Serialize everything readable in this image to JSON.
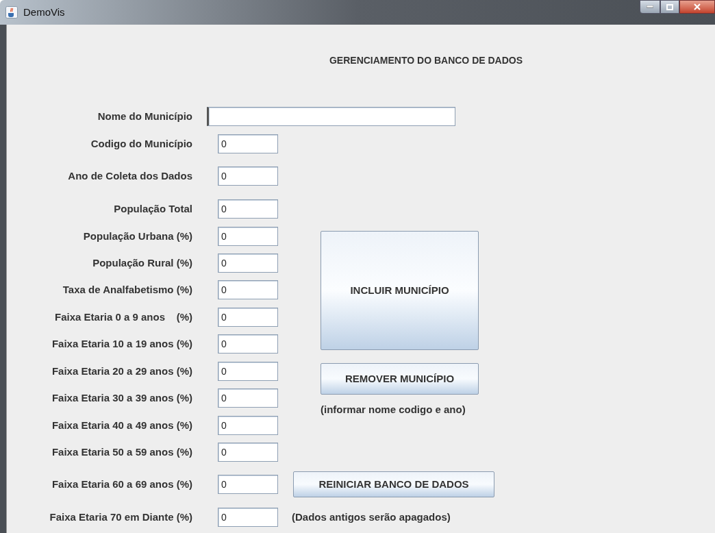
{
  "window": {
    "title": "DemoVis"
  },
  "heading": "GERENCIAMENTO DO BANCO DE DADOS",
  "fields": [
    {
      "label": "Nome do Município",
      "focused": true,
      "kind": "wide"
    },
    {
      "label": "Codigo do Município",
      "value": "0",
      "focused": false,
      "kind": "short"
    },
    {
      "label": "Ano de Coleta dos Dados",
      "value": "0",
      "focused": false,
      "kind": "short"
    },
    {
      "label": "População Total",
      "value": "0",
      "focused": false,
      "kind": "short"
    },
    {
      "label": "População Urbana (%)",
      "value": "0",
      "focused": false,
      "kind": "short"
    },
    {
      "label": "População Rural (%)",
      "value": "0",
      "focused": false,
      "kind": "short"
    },
    {
      "label": "Taxa de Analfabetismo (%)",
      "value": "0",
      "focused": false,
      "kind": "short"
    },
    {
      "label": "Faixa Etaria 0 a 9 anos    (%)",
      "value": "0",
      "focused": false,
      "kind": "short"
    },
    {
      "label": "Faixa Etaria 10 a 19 anos (%)",
      "value": "0",
      "focused": false,
      "kind": "short"
    },
    {
      "label": "Faixa Etaria 20 a 29 anos (%)",
      "value": "0",
      "focused": false,
      "kind": "short"
    },
    {
      "label": "Faixa Etaria 30 a 39 anos (%)",
      "value": "0",
      "focused": false,
      "kind": "short"
    },
    {
      "label": "Faixa Etaria 40 a 49 anos (%)",
      "value": "0",
      "focused": false,
      "kind": "short"
    },
    {
      "label": "Faixa Etaria 50 a 59 anos (%)",
      "value": "0",
      "focused": false,
      "kind": "short"
    },
    {
      "label": "Faixa Etaria 60 a 69 anos (%)",
      "value": "0",
      "focused": false,
      "kind": "short"
    },
    {
      "label": "Faixa Etaria 70 em Diante (%)",
      "value": "0",
      "focused": false,
      "kind": "short"
    }
  ],
  "include_button": "INCLUIR MUNICÍPIO",
  "remove_button": "REMOVER MUNICÍPIO",
  "remove_note": "(informar nome codigo e ano)",
  "reset_button": "REINICIAR BANCO DE DADOS",
  "reset_note": "(Dados antigos serão apagados)"
}
